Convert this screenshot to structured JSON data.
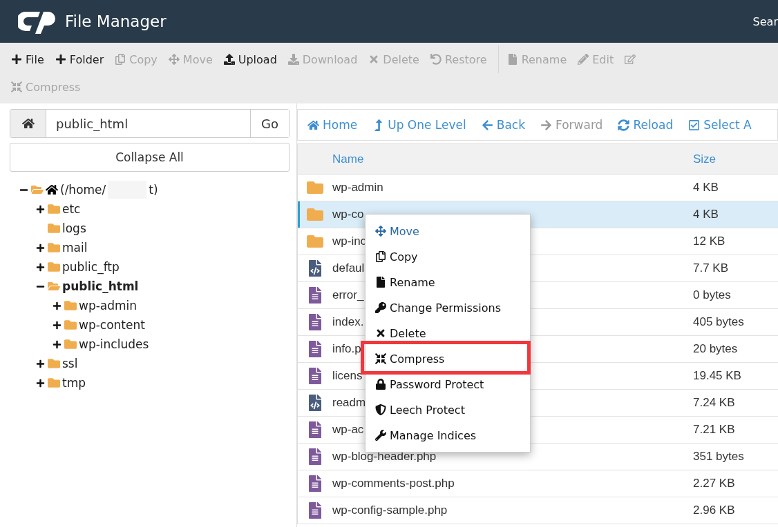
{
  "header": {
    "title": "File Manager",
    "search_label": "Sear"
  },
  "toolbar": [
    {
      "label": "File",
      "disabled": false
    },
    {
      "label": "Folder",
      "disabled": false
    },
    {
      "label": "Copy",
      "disabled": true
    },
    {
      "label": "Move",
      "disabled": true
    },
    {
      "label": "Upload",
      "disabled": false
    },
    {
      "label": "Download",
      "disabled": true
    },
    {
      "label": "Delete",
      "disabled": true
    },
    {
      "label": "Restore",
      "disabled": true
    },
    {
      "label": "Rename",
      "disabled": true
    },
    {
      "label": "Edit",
      "disabled": true
    },
    {
      "label": "Compress",
      "disabled": true
    }
  ],
  "path_bar": {
    "value": "public_html",
    "go": "Go"
  },
  "collapse_all": "Collapse All",
  "tree": {
    "label": "(/home/",
    "label_end": "t)",
    "expanded": true,
    "children": [
      {
        "label": "etc",
        "kind": "expandable",
        "expanded": false,
        "selected": false
      },
      {
        "label": "logs",
        "kind": "leaf",
        "expanded": false,
        "selected": false
      },
      {
        "label": "mail",
        "kind": "expandable",
        "expanded": false,
        "selected": false
      },
      {
        "label": "public_ftp",
        "kind": "expandable",
        "expanded": false,
        "selected": false
      },
      {
        "label": "public_html",
        "kind": "expandable",
        "expanded": true,
        "selected": true,
        "children": [
          {
            "label": "wp-admin",
            "kind": "expandable",
            "expanded": false,
            "selected": false
          },
          {
            "label": "wp-content",
            "kind": "expandable",
            "expanded": false,
            "selected": false
          },
          {
            "label": "wp-includes",
            "kind": "expandable",
            "expanded": false,
            "selected": false
          }
        ]
      },
      {
        "label": "ssl",
        "kind": "expandable",
        "expanded": false,
        "selected": false
      },
      {
        "label": "tmp",
        "kind": "expandable",
        "expanded": false,
        "selected": false
      }
    ]
  },
  "nav": [
    {
      "label": "Home",
      "disabled": false
    },
    {
      "label": "Up One Level",
      "disabled": false
    },
    {
      "label": "Back",
      "disabled": false
    },
    {
      "label": "Forward",
      "disabled": true
    },
    {
      "label": "Reload",
      "disabled": false
    },
    {
      "label": "Select A",
      "disabled": false
    }
  ],
  "table": {
    "columns": [
      "Name",
      "Size"
    ],
    "rows": [
      {
        "kind": "folder",
        "name": "wp-admin",
        "size": "4 KB",
        "selected": false
      },
      {
        "kind": "folder",
        "name": "wp-co",
        "size": "4 KB",
        "selected": true
      },
      {
        "kind": "folder",
        "name": "wp-inc",
        "size": "12 KB",
        "selected": false
      },
      {
        "kind": "code",
        "name": "defaul",
        "size": "7.7 KB",
        "selected": false
      },
      {
        "kind": "text",
        "name": "error_",
        "size": "0 bytes",
        "selected": false
      },
      {
        "kind": "text",
        "name": "index.",
        "size": "405 bytes",
        "selected": false
      },
      {
        "kind": "text",
        "name": "info.p",
        "size": "20 bytes",
        "selected": false
      },
      {
        "kind": "text",
        "name": "licens",
        "size": "19.45 KB",
        "selected": false
      },
      {
        "kind": "code",
        "name": "readm",
        "size": "7.24 KB",
        "selected": false
      },
      {
        "kind": "text",
        "name": "wp-ac",
        "size": "7.21 KB",
        "selected": false
      },
      {
        "kind": "text",
        "name": "wp-blog-header.php",
        "size": "351 bytes",
        "selected": false
      },
      {
        "kind": "text",
        "name": "wp-comments-post.php",
        "size": "2.27 KB",
        "selected": false
      },
      {
        "kind": "text",
        "name": "wp-config-sample.php",
        "size": "2.96 KB",
        "selected": false
      }
    ]
  },
  "context_menu": [
    {
      "label": "Move",
      "selected": true,
      "outlined": false
    },
    {
      "label": "Copy",
      "selected": false,
      "outlined": false
    },
    {
      "label": "Rename",
      "selected": false,
      "outlined": false
    },
    {
      "label": "Change Permissions",
      "selected": false,
      "outlined": false
    },
    {
      "label": "Delete",
      "selected": false,
      "outlined": false
    },
    {
      "label": "Compress",
      "selected": false,
      "outlined": true
    },
    {
      "label": "Password Protect",
      "selected": false,
      "outlined": false
    },
    {
      "label": "Leech Protect",
      "selected": false,
      "outlined": false
    },
    {
      "label": "Manage Indices",
      "selected": false,
      "outlined": false
    }
  ]
}
